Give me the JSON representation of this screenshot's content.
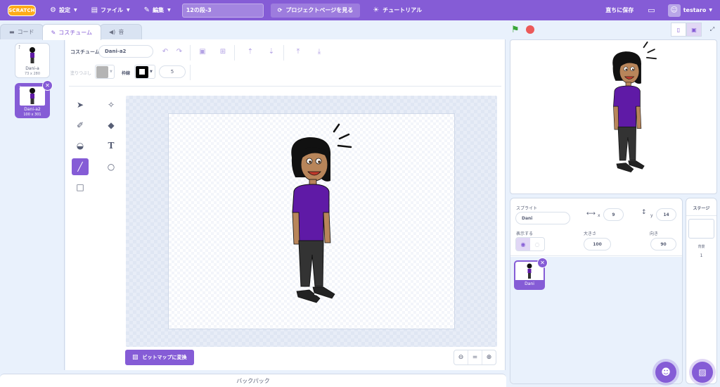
{
  "menubar": {
    "logo": "SCRATCH",
    "settings": "設定",
    "file": "ファイル",
    "edit": "編集",
    "project_title": "12の段-3",
    "project_page": "プロジェクトページを見る",
    "tutorials": "チュートリアル",
    "save_now": "直ちに保存",
    "username": "testaro"
  },
  "tabs": {
    "code": "コード",
    "costumes": "コスチューム",
    "sounds": "音"
  },
  "costumes": [
    {
      "num": "1",
      "name": "Dani-a",
      "size": "73 x 280"
    },
    {
      "num": "2",
      "name": "Dani-a2",
      "size": "100 x 301"
    }
  ],
  "paint": {
    "costume_label": "コスチューム",
    "costume_name": "Dani-a2",
    "fill_label": "塗りつぶし",
    "outline_label": "枠線",
    "outline_width": "5",
    "convert_bitmap": "ビットマップに変換",
    "zoom_reset": "="
  },
  "backpack": "バックパック",
  "sprite_info": {
    "sprite_label": "スプライト",
    "sprite_name": "Dani",
    "x_label": "x",
    "x_value": "9",
    "y_label": "y",
    "y_value": "14",
    "show_label": "表示する",
    "size_label": "大きさ",
    "size_value": "100",
    "direction_label": "向き",
    "direction_value": "90"
  },
  "sprites": [
    {
      "name": "Dani"
    }
  ],
  "stage_panel": {
    "header": "ステージ",
    "backdrops_label": "背景",
    "backdrops_count": "1"
  },
  "colors": {
    "accent": "#855cd6",
    "fill": "#b4b4b4",
    "outline": "#000000",
    "shirt": "#5f1aa6",
    "skin": "#b8855a"
  }
}
